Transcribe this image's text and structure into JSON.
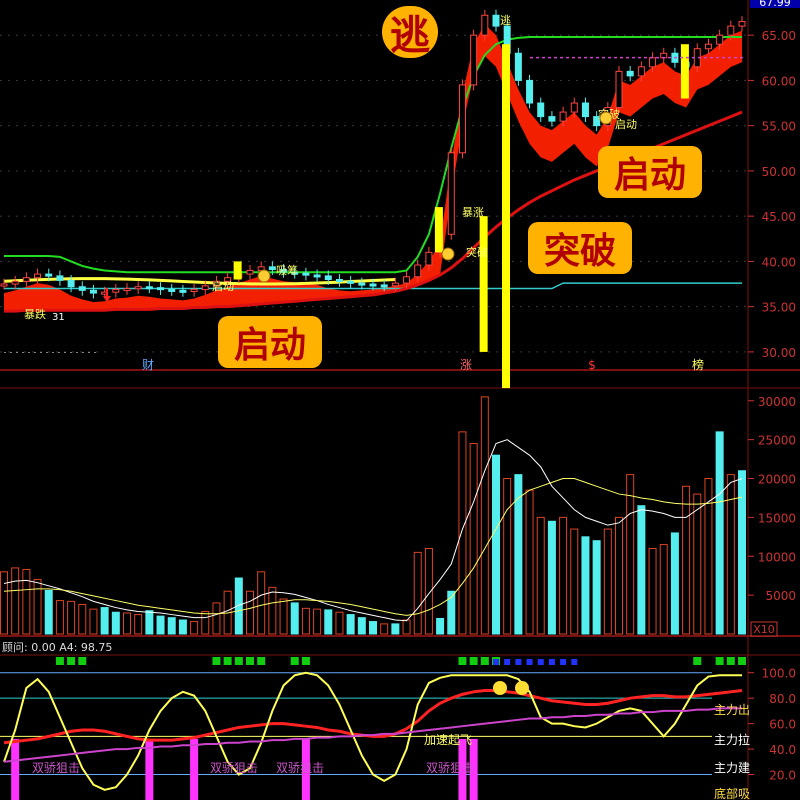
{
  "colors": {
    "background": "#000000",
    "border": "#7a1010",
    "price_ribbon": "#ff2200",
    "ma_red": "#dd1111",
    "ma_green": "#22dd22",
    "ma_yellow": "#ffff44",
    "ma_cyan": "#33cccc",
    "vol_up": "#dd4422",
    "vol_down": "#55eeee",
    "badge": "#ffb300",
    "axis_text": "#cc3333"
  },
  "price_panel": {
    "top_value": "67.99",
    "y_ticks": [
      "65.00",
      "60.00",
      "55.00",
      "50.00",
      "45.00",
      "40.00",
      "35.00",
      "30.00"
    ],
    "bottom_markers": [
      "财",
      "涨",
      "$",
      "榜"
    ],
    "callouts": {
      "escape": "逃",
      "start_right": "启动",
      "breakout": "突破",
      "start_left": "启动"
    },
    "small_labels": [
      "暴涨",
      "突破",
      "启动",
      "突破",
      "吸筹",
      "逃",
      "启动",
      "暴跌"
    ],
    "low_label": "31"
  },
  "volume_panel": {
    "y_ticks": [
      "30000",
      "25000",
      "20000",
      "15000",
      "10000",
      "5000"
    ],
    "unit": "X10"
  },
  "indicator_panel": {
    "header": "顾问: 0.00  A4: 98.75",
    "y_ticks": [
      "100.0",
      "80.0",
      "60.0",
      "40.0",
      "20.0"
    ],
    "zone_labels": [
      "主力出",
      "主力拉",
      "主力建",
      "底部吸"
    ],
    "signal_labels": [
      "双骄狙击",
      "双骄狙击",
      "双骄狙击",
      "加速起飞"
    ]
  },
  "chart_data": [
    {
      "type": "candlestick",
      "title": "",
      "y_range": [
        28,
        68
      ],
      "close": [
        37.5,
        37.8,
        38.2,
        38.6,
        38.4,
        37.9,
        37.2,
        36.8,
        36.5,
        36.6,
        36.9,
        37.0,
        37.2,
        37.1,
        36.9,
        36.8,
        36.7,
        36.9,
        37.3,
        37.8,
        38.2,
        38.6,
        39.0,
        39.4,
        39.1,
        38.8,
        38.7,
        38.5,
        38.4,
        38.0,
        37.8,
        37.6,
        37.5,
        37.4,
        37.3,
        37.6,
        38.3,
        39.6,
        41.0,
        43.0,
        52.0,
        59.5,
        65.0,
        67.2,
        66.0,
        63.0,
        60.0,
        57.5,
        56.0,
        55.5,
        56.5,
        57.5,
        56.0,
        55.0,
        57.0,
        61.0,
        60.5,
        61.5,
        62.5,
        63.0,
        62.0,
        61.5,
        63.5,
        64.0,
        65.0,
        66.0,
        66.5
      ],
      "ma_long_red": [
        34.5,
        34.5,
        34.6,
        34.6,
        34.6,
        34.6,
        34.6,
        34.6,
        34.6,
        34.6,
        34.7,
        34.7,
        34.7,
        34.7,
        34.8,
        34.8,
        34.8,
        34.9,
        34.9,
        35.0,
        35.0,
        35.1,
        35.2,
        35.3,
        35.4,
        35.5,
        35.6,
        35.7,
        35.8,
        35.9,
        36.0,
        36.1,
        36.2,
        36.3,
        36.5,
        36.7,
        37.0,
        37.4,
        37.9,
        38.5,
        39.3,
        40.3,
        41.5,
        42.7,
        43.8,
        44.8,
        45.7,
        46.5,
        47.2,
        47.8,
        48.4,
        49.0,
        49.5,
        50.0,
        50.5,
        51.0,
        51.5,
        52.0,
        52.5,
        53.0,
        53.5,
        54.0,
        54.5,
        55.0,
        55.5,
        56.0,
        56.5
      ],
      "ma_green": [
        40.6,
        40.6,
        40.6,
        40.6,
        40.6,
        40.5,
        40.0,
        39.5,
        39.2,
        39.0,
        38.9,
        38.8,
        38.8,
        38.8,
        38.8,
        38.8,
        38.8,
        38.8,
        38.8,
        38.8,
        38.8,
        38.8,
        38.8,
        38.8,
        38.8,
        38.8,
        38.8,
        38.8,
        38.8,
        38.8,
        38.8,
        38.8,
        38.8,
        38.8,
        38.8,
        38.8,
        39.0,
        40.5,
        43.0,
        47.5,
        52.5,
        57.0,
        60.5,
        62.8,
        64.0,
        64.5,
        64.7,
        64.8,
        64.8,
        64.8,
        64.8,
        64.8,
        64.8,
        64.8,
        64.8,
        64.8,
        64.8,
        64.8,
        64.8,
        64.8,
        64.8,
        64.8,
        64.8,
        64.8,
        64.8,
        64.8,
        64.8
      ],
      "ma_cyan": [
        37.0,
        37.0,
        37.0,
        37.0,
        37.0,
        37.0,
        37.0,
        37.0,
        37.0,
        37.0,
        37.0,
        37.0,
        37.0,
        37.0,
        37.0,
        37.0,
        37.0,
        37.0,
        37.0,
        37.0,
        37.0,
        37.0,
        37.0,
        37.0,
        37.0,
        37.0,
        37.0,
        37.0,
        37.0,
        37.0,
        37.0,
        37.0,
        37.0,
        37.0,
        37.0,
        37.0,
        37.0,
        37.0,
        37.0,
        37.0,
        37.0,
        37.0,
        37.0,
        37.0,
        37.0,
        37.0,
        37.0,
        37.0,
        37.0,
        37.0,
        37.6,
        37.6,
        37.6,
        37.6,
        37.6,
        37.6,
        37.6,
        37.6,
        37.6,
        37.6,
        37.6,
        37.6,
        37.6,
        37.6,
        37.6,
        37.6,
        37.6
      ]
    },
    {
      "type": "bar",
      "title": "",
      "y_range": [
        0,
        31000
      ],
      "values": [
        8000,
        8500,
        8300,
        7000,
        5600,
        4300,
        4200,
        3800,
        3200,
        3400,
        2800,
        2700,
        2500,
        3000,
        2300,
        2100,
        1800,
        1600,
        2900,
        4000,
        5500,
        7200,
        5500,
        8000,
        6000,
        4500,
        4000,
        3300,
        3200,
        3100,
        2800,
        2500,
        2100,
        1600,
        1300,
        1300,
        1800,
        10500,
        11000,
        2000,
        5500,
        26000,
        24500,
        30500,
        23000,
        20000,
        20500,
        18500,
        15000,
        14500,
        15000,
        13500,
        12500,
        12000,
        13500,
        15000,
        20500,
        16500,
        11000,
        11500,
        13000,
        19000,
        18000,
        20000,
        26000,
        20500,
        21000
      ],
      "up": [
        true,
        true,
        true,
        true,
        false,
        true,
        true,
        true,
        true,
        false,
        false,
        true,
        true,
        false,
        false,
        false,
        false,
        true,
        true,
        true,
        true,
        false,
        true,
        true,
        true,
        true,
        false,
        true,
        true,
        false,
        true,
        false,
        false,
        false,
        true,
        false,
        true,
        true,
        true,
        false,
        false,
        true,
        true,
        true,
        false,
        true,
        false,
        true,
        true,
        false,
        true,
        true,
        false,
        false,
        true,
        true,
        true,
        false,
        true,
        true,
        false,
        true,
        true,
        true,
        false,
        true,
        false
      ],
      "ma1": [
        6500,
        6800,
        6900,
        6600,
        6200,
        5800,
        5300,
        4800,
        4200,
        3800,
        3400,
        3100,
        2900,
        2800,
        2700,
        2500,
        2300,
        2100,
        2100,
        2500,
        3000,
        3700,
        4200,
        5000,
        5400,
        5300,
        5100,
        4700,
        4300,
        3800,
        3400,
        3000,
        2700,
        2400,
        2100,
        1800,
        1700,
        3300,
        5200,
        7000,
        9000,
        13500,
        17000,
        21000,
        24500,
        25000,
        24000,
        23000,
        21500,
        19000,
        17500,
        16000,
        15000,
        14500,
        14000,
        14300,
        15500,
        16000,
        15800,
        15500,
        15000,
        15000,
        16000,
        17000,
        18000,
        19500,
        20000
      ],
      "ma2": [
        5500,
        5600,
        5700,
        5800,
        5800,
        5700,
        5500,
        5200,
        4900,
        4600,
        4300,
        4000,
        3700,
        3500,
        3300,
        3100,
        2900,
        2700,
        2600,
        2600,
        2700,
        3000,
        3300,
        3700,
        4000,
        4200,
        4400,
        4400,
        4300,
        4200,
        4000,
        3800,
        3500,
        3200,
        2900,
        2600,
        2400,
        2600,
        3100,
        3800,
        4700,
        6500,
        8500,
        11000,
        13500,
        16000,
        17500,
        18500,
        19000,
        19500,
        20000,
        20000,
        19500,
        19000,
        18500,
        18000,
        17800,
        17500,
        17300,
        17000,
        16800,
        16700,
        16700,
        16800,
        17000,
        17300,
        17600
      ]
    },
    {
      "type": "line",
      "title": "",
      "y_range": [
        0,
        115
      ],
      "series": [
        {
          "values": [
            45,
            46,
            47,
            48,
            50,
            52,
            54,
            55,
            55,
            54,
            52,
            50,
            48,
            47,
            47,
            47,
            48,
            49,
            51,
            53,
            55,
            57,
            58,
            59,
            60,
            60,
            59,
            58,
            57,
            55,
            54,
            52,
            51,
            50,
            50,
            52,
            56,
            62,
            70,
            76,
            80,
            83,
            85,
            86,
            86,
            85,
            84,
            82,
            80,
            78,
            77,
            76,
            75,
            75,
            76,
            78,
            80,
            81,
            82,
            82,
            81,
            81,
            82,
            83,
            84,
            85,
            86
          ]
        },
        {
          "values": [
            30,
            55,
            88,
            95,
            85,
            65,
            45,
            25,
            12,
            8,
            10,
            20,
            35,
            55,
            70,
            80,
            85,
            82,
            70,
            50,
            30,
            20,
            25,
            45,
            70,
            90,
            98,
            100,
            98,
            90,
            75,
            55,
            35,
            20,
            15,
            20,
            40,
            75,
            92,
            96,
            98,
            98,
            98,
            98,
            98,
            98,
            95,
            85,
            65,
            60,
            60,
            58,
            57,
            60,
            65,
            70,
            72,
            70,
            60,
            50,
            60,
            75,
            90,
            97,
            98,
            98,
            98
          ]
        },
        {
          "values": [
            30,
            31,
            32,
            33,
            34,
            35,
            36,
            37,
            38,
            39,
            40,
            40,
            41,
            41,
            42,
            42,
            43,
            43,
            44,
            44,
            45,
            45,
            46,
            46,
            47,
            47,
            48,
            48,
            49,
            49,
            50,
            50,
            51,
            51,
            52,
            52,
            53,
            54,
            55,
            56,
            57,
            58,
            59,
            60,
            61,
            62,
            63,
            64,
            64,
            65,
            65,
            66,
            66,
            67,
            67,
            68,
            68,
            69,
            69,
            70,
            70,
            70,
            71,
            71,
            72,
            72,
            72
          ]
        }
      ]
    }
  ]
}
